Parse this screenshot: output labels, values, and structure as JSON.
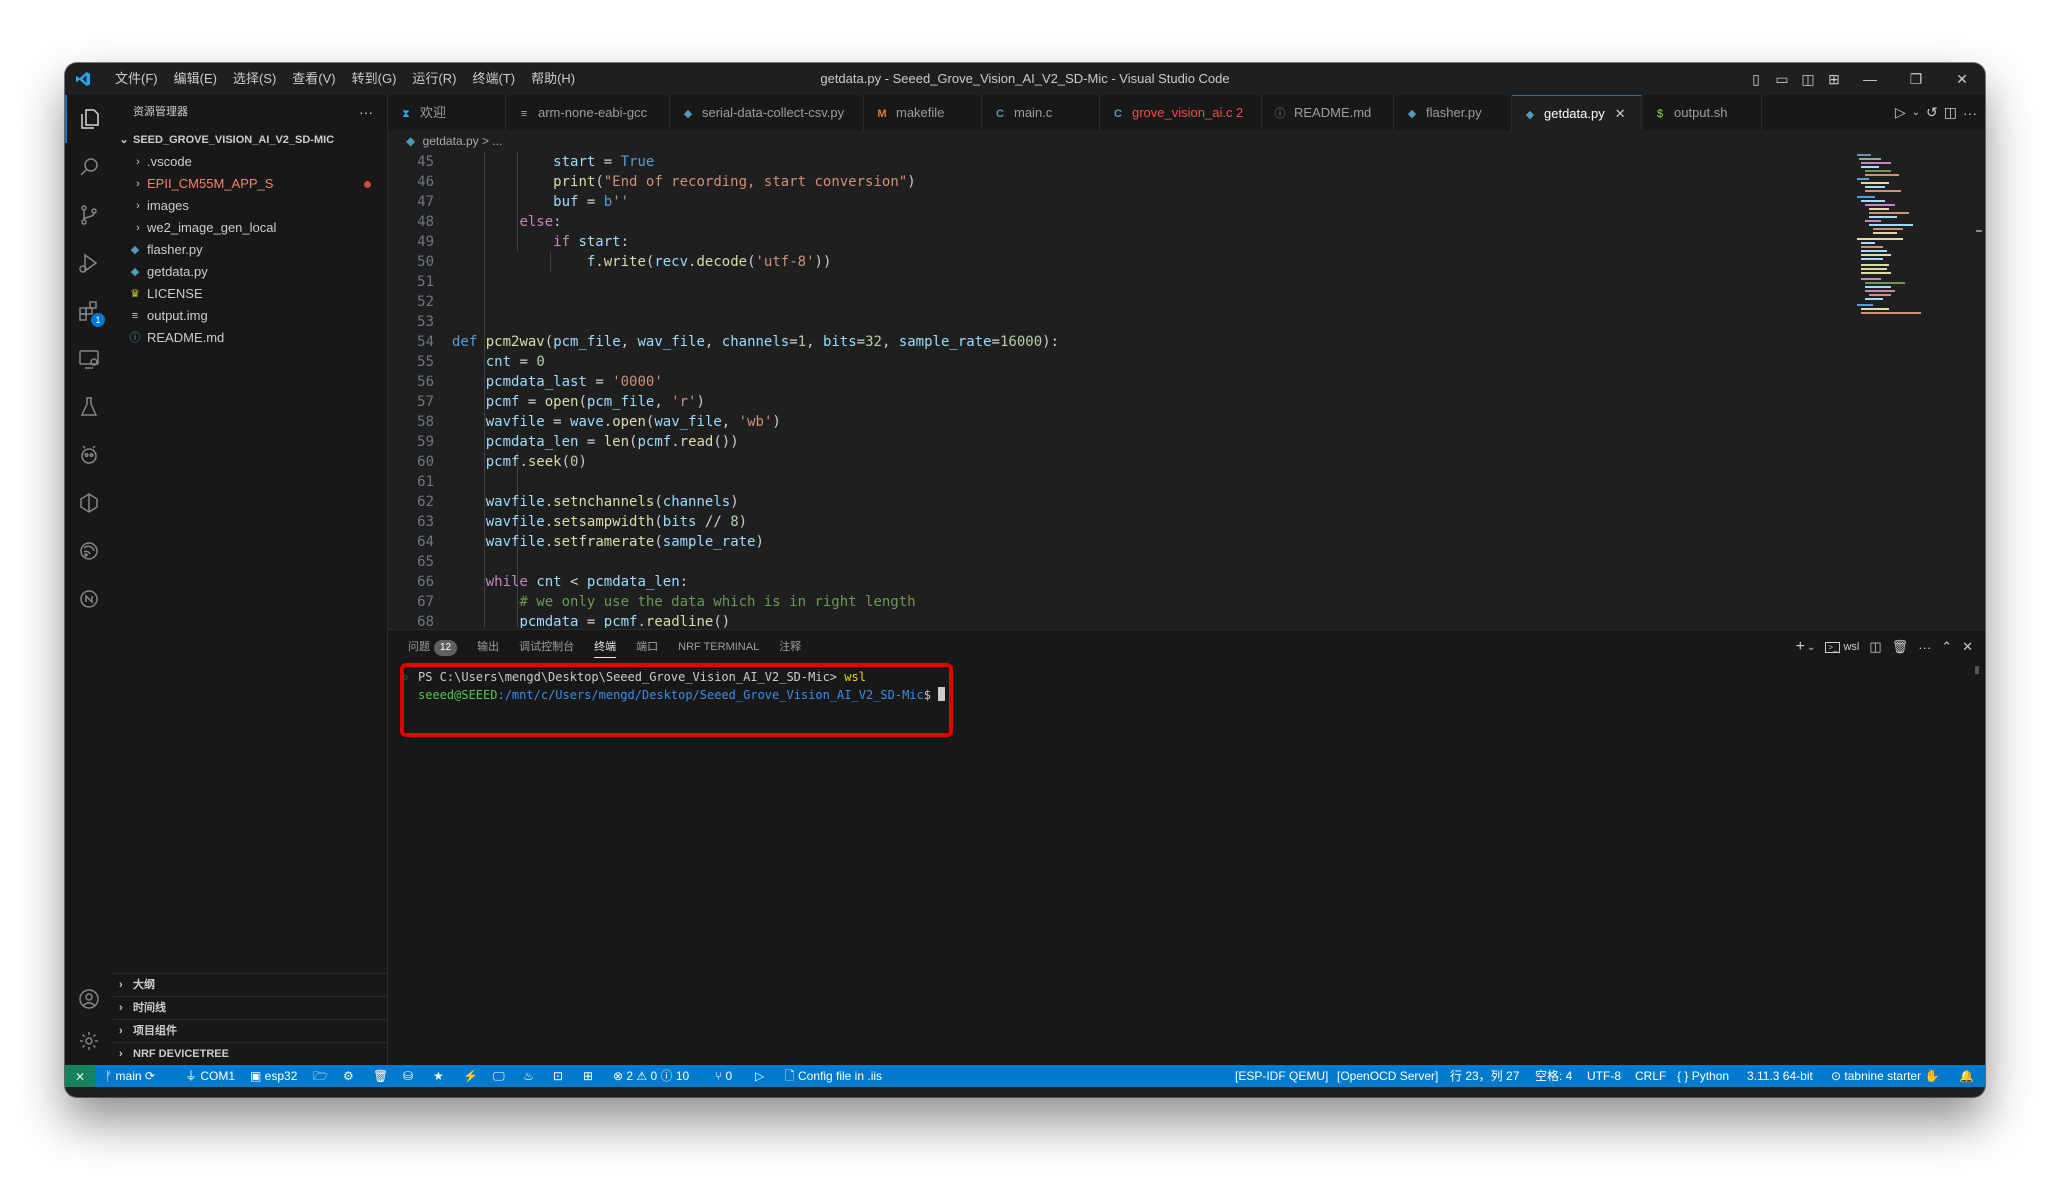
{
  "window": {
    "title": "getdata.py - Seeed_Grove_Vision_AI_V2_SD-Mic - Visual Studio Code",
    "menu": [
      "文件(F)",
      "编辑(E)",
      "选择(S)",
      "查看(V)",
      "转到(G)",
      "运行(R)",
      "终端(T)",
      "帮助(H)"
    ]
  },
  "sidebar": {
    "header": "资源管理器",
    "root": "SEED_GROVE_VISION_AI_V2_SD-MIC",
    "items": [
      {
        "label": ".vscode",
        "type": "folder"
      },
      {
        "label": "EPII_CM55M_APP_S",
        "type": "folder",
        "modified": true
      },
      {
        "label": "images",
        "type": "folder"
      },
      {
        "label": "we2_image_gen_local",
        "type": "folder"
      },
      {
        "label": "flasher.py",
        "type": "python"
      },
      {
        "label": "getdata.py",
        "type": "python"
      },
      {
        "label": "LICENSE",
        "type": "license"
      },
      {
        "label": "output.img",
        "type": "file"
      },
      {
        "label": "README.md",
        "type": "info"
      }
    ],
    "sections": [
      "大纲",
      "时间线",
      "项目组件",
      "NRF DEVICETREE"
    ]
  },
  "tabs": [
    {
      "label": "欢迎",
      "icon": "vscode-icon"
    },
    {
      "label": "arm-none-eabi-gcc",
      "icon": "lines-icon"
    },
    {
      "label": "serial-data-collect-csv.py",
      "icon": "python-icon"
    },
    {
      "label": "makefile",
      "icon": "m-icon"
    },
    {
      "label": "main.c",
      "icon": "c-icon"
    },
    {
      "label": "grove_vision_ai.c 2",
      "icon": "c-icon"
    },
    {
      "label": "README.md",
      "icon": "info-icon"
    },
    {
      "label": "flasher.py",
      "icon": "python-icon"
    },
    {
      "label": "getdata.py",
      "icon": "python-icon",
      "active": true
    },
    {
      "label": "output.sh",
      "icon": "dollar-icon"
    }
  ],
  "breadcrumb": "getdata.py > ...",
  "code": [
    {
      "n": "45",
      "t": "            start = True"
    },
    {
      "n": "46",
      "t": "            print(\"End of recording, start conversion\")"
    },
    {
      "n": "47",
      "t": "            buf = b''"
    },
    {
      "n": "48",
      "t": "        else:"
    },
    {
      "n": "49",
      "t": "            if start:"
    },
    {
      "n": "50",
      "t": "                f.write(recv.decode('utf-8'))"
    },
    {
      "n": "51",
      "t": ""
    },
    {
      "n": "52",
      "t": ""
    },
    {
      "n": "53",
      "t": ""
    },
    {
      "n": "54",
      "t": "def pcm2wav(pcm_file, wav_file, channels=1, bits=32, sample_rate=16000):"
    },
    {
      "n": "55",
      "t": "    cnt = 0"
    },
    {
      "n": "56",
      "t": "    pcmdata_last = '0000'"
    },
    {
      "n": "57",
      "t": "    pcmf = open(pcm_file, 'r')"
    },
    {
      "n": "58",
      "t": "    wavfile = wave.open(wav_file, 'wb')"
    },
    {
      "n": "59",
      "t": "    pcmdata_len = len(pcmf.read())"
    },
    {
      "n": "60",
      "t": "    pcmf.seek(0)"
    },
    {
      "n": "61",
      "t": ""
    },
    {
      "n": "62",
      "t": "    wavfile.setnchannels(channels)"
    },
    {
      "n": "63",
      "t": "    wavfile.setsampwidth(bits // 8)"
    },
    {
      "n": "64",
      "t": "    wavfile.setframerate(sample_rate)"
    },
    {
      "n": "65",
      "t": ""
    },
    {
      "n": "66",
      "t": "    while cnt < pcmdata_len:"
    },
    {
      "n": "67",
      "t": "        # we only use the data which is in right length"
    },
    {
      "n": "68",
      "t": "        pcmdata = pcmf.readline()"
    }
  ],
  "panel": {
    "tabs": [
      {
        "label": "问题",
        "badge": "12"
      },
      {
        "label": "输出"
      },
      {
        "label": "调试控制台"
      },
      {
        "label": "终端",
        "active": true
      },
      {
        "label": "端口"
      },
      {
        "label": "NRF TERMINAL"
      },
      {
        "label": "注释"
      }
    ],
    "shell_label": "wsl",
    "terminal": {
      "line1_prompt": "PS C:\\Users\\mengd\\Desktop\\Seeed_Grove_Vision_AI_V2_SD-Mic> ",
      "line1_cmd": "wsl",
      "line2_user": "seeed@SEEED",
      "line2_path": ":/mnt/c/Users/mengd/Desktop/Seeed_Grove_Vision_AI_V2_SD-Mic",
      "line2_suffix": "$ "
    },
    "highlight_color": "#e00000"
  },
  "statusbar": {
    "branch": "main",
    "port": "COM1",
    "target": "esp32",
    "problems": "⊗ 2 ⚠ 0 ⓘ 10",
    "ports": "0",
    "config": "Config file in .iis",
    "qemu": "[ESP-IDF QEMU]",
    "openocd": "[OpenOCD Server]",
    "position": "行 23，列 27",
    "spaces": "空格: 4",
    "encoding": "UTF-8",
    "eol": "CRLF",
    "language": "Python",
    "interpreter": "3.11.3 64-bit",
    "tabnine": "tabnine starter"
  },
  "colors": {
    "accent": "#0078d4",
    "statusbar": "#007acc",
    "remote": "#16825d",
    "editor_bg": "#1f1f1f"
  }
}
